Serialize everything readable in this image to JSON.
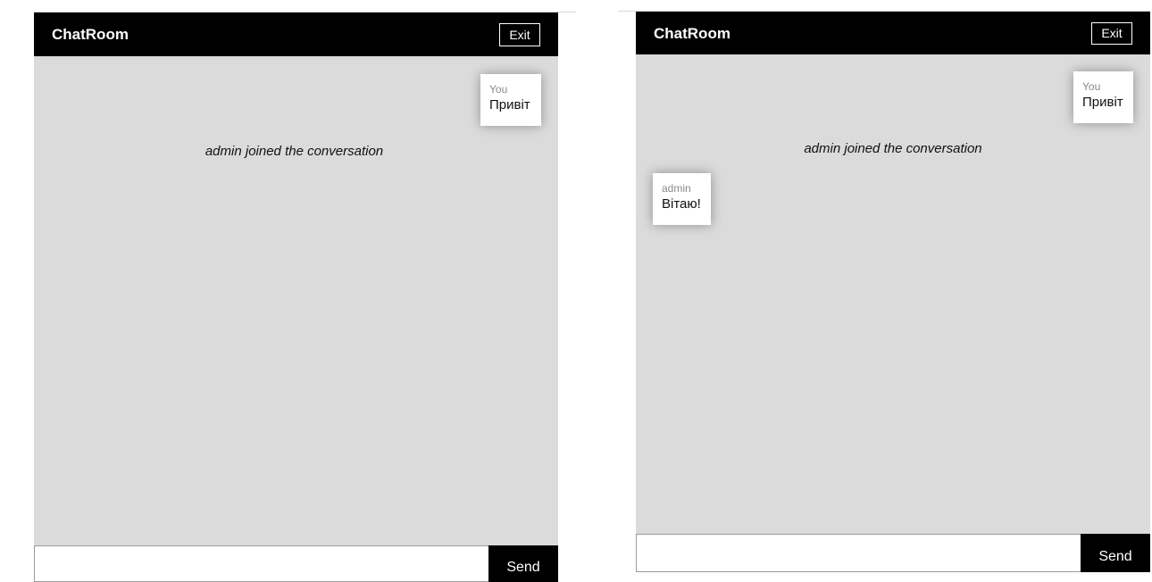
{
  "panels": [
    {
      "header": {
        "title": "ChatRoom",
        "exit_label": "Exit"
      },
      "messages": {
        "outgoing": {
          "author": "You",
          "text": "Привіт"
        },
        "system": "admin joined the conversation"
      },
      "composer": {
        "input_value": "",
        "send_label": "Send"
      }
    },
    {
      "header": {
        "title": "ChatRoom",
        "exit_label": "Exit"
      },
      "messages": {
        "outgoing": {
          "author": "You",
          "text": "Привіт"
        },
        "system": "admin joined the conversation",
        "incoming": {
          "author": "admin",
          "text": "Вітаю!"
        }
      },
      "composer": {
        "input_value": "",
        "send_label": "Send"
      }
    }
  ],
  "colors": {
    "header_bg": "#000000",
    "chat_bg": "#dbdbdb",
    "bubble_bg": "#ffffff",
    "author_text": "#8a8a8a"
  }
}
